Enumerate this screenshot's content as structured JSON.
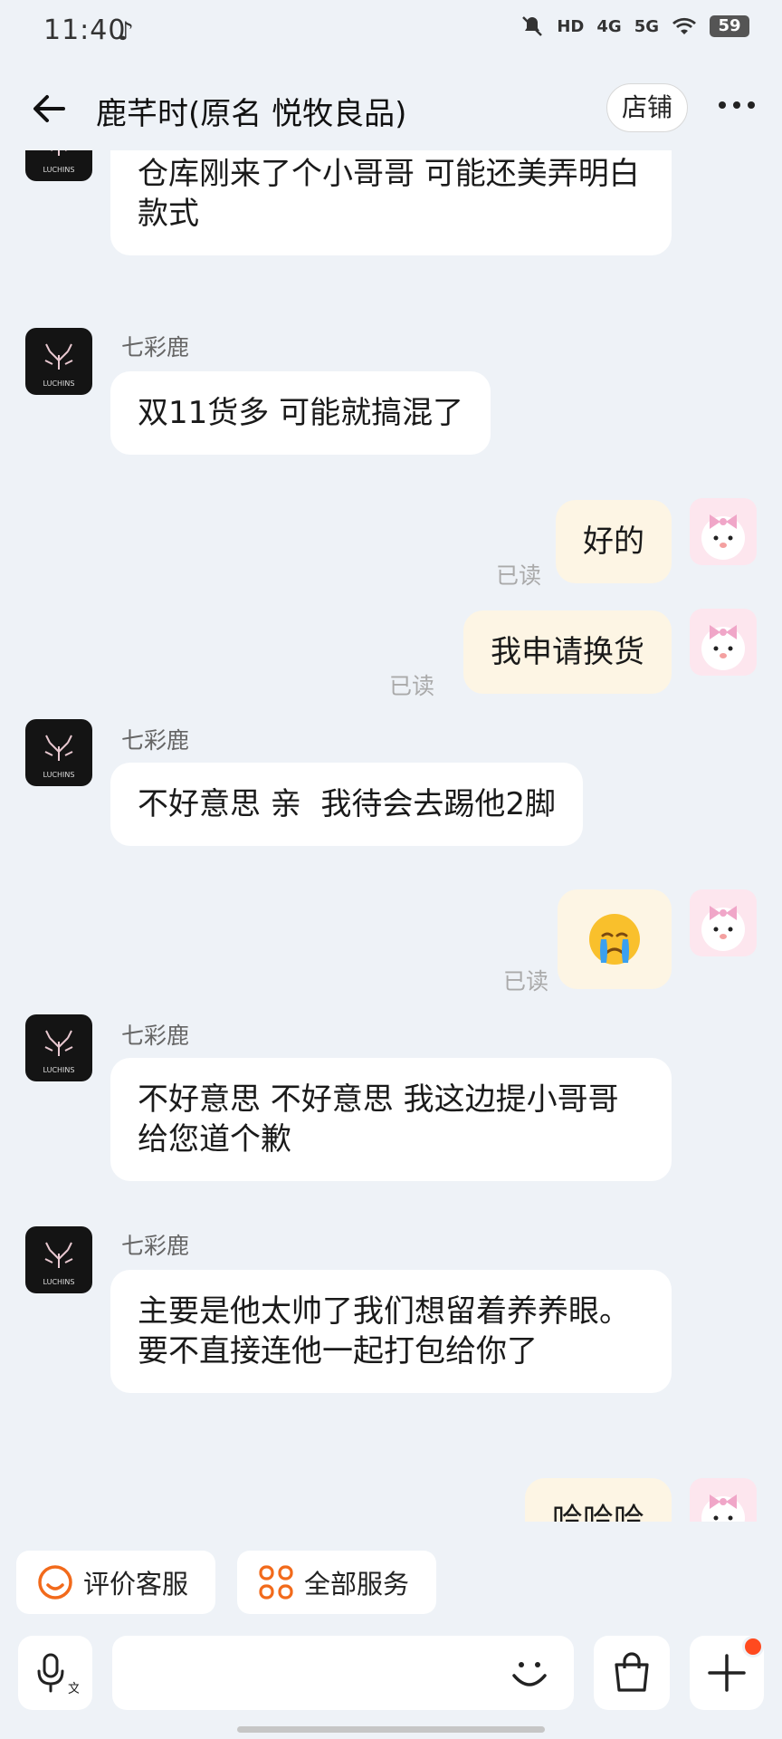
{
  "status_bar": {
    "time": "11:40",
    "signal_4g": "4G",
    "signal_5g": "5G",
    "hd": "HD",
    "battery": "59"
  },
  "header": {
    "title": "鹿芊时(原名 悦牧良品)",
    "shop_button": "店铺"
  },
  "messages": [
    {
      "from": "shop",
      "text": "仓库刚来了个小哥哥 可能还美弄明白款式"
    },
    {
      "from": "shop",
      "sender": "七彩鹿",
      "text": "双11货多 可能就搞混了"
    },
    {
      "from": "user",
      "text": "好的",
      "read": "已读"
    },
    {
      "from": "user",
      "text": "我申请换货",
      "read": "已读"
    },
    {
      "from": "shop",
      "sender": "七彩鹿",
      "text": "不好意思 亲  我待会去踢他2脚"
    },
    {
      "from": "user",
      "emoji": "crying-face",
      "read": "已读"
    },
    {
      "from": "shop",
      "sender": "七彩鹿",
      "text": "不好意思 不好意思 我这边提小哥哥给您道个歉"
    },
    {
      "from": "shop",
      "sender": "七彩鹿",
      "text": "主要是他太帅了我们想留着养养眼。要不直接连他一起打包给你了"
    },
    {
      "from": "user",
      "text": "哈哈哈"
    }
  ],
  "quick_actions": [
    {
      "label": "评价客服",
      "icon": "smile-icon"
    },
    {
      "label": "全部服务",
      "icon": "grid-icon"
    }
  ],
  "input_bar": {
    "voice_label": "文"
  },
  "colors": {
    "accent": "#f26a1b",
    "background": "#eef2f7",
    "bubble_out": "#fdf5e4",
    "notify_dot": "#ff4a1f"
  }
}
